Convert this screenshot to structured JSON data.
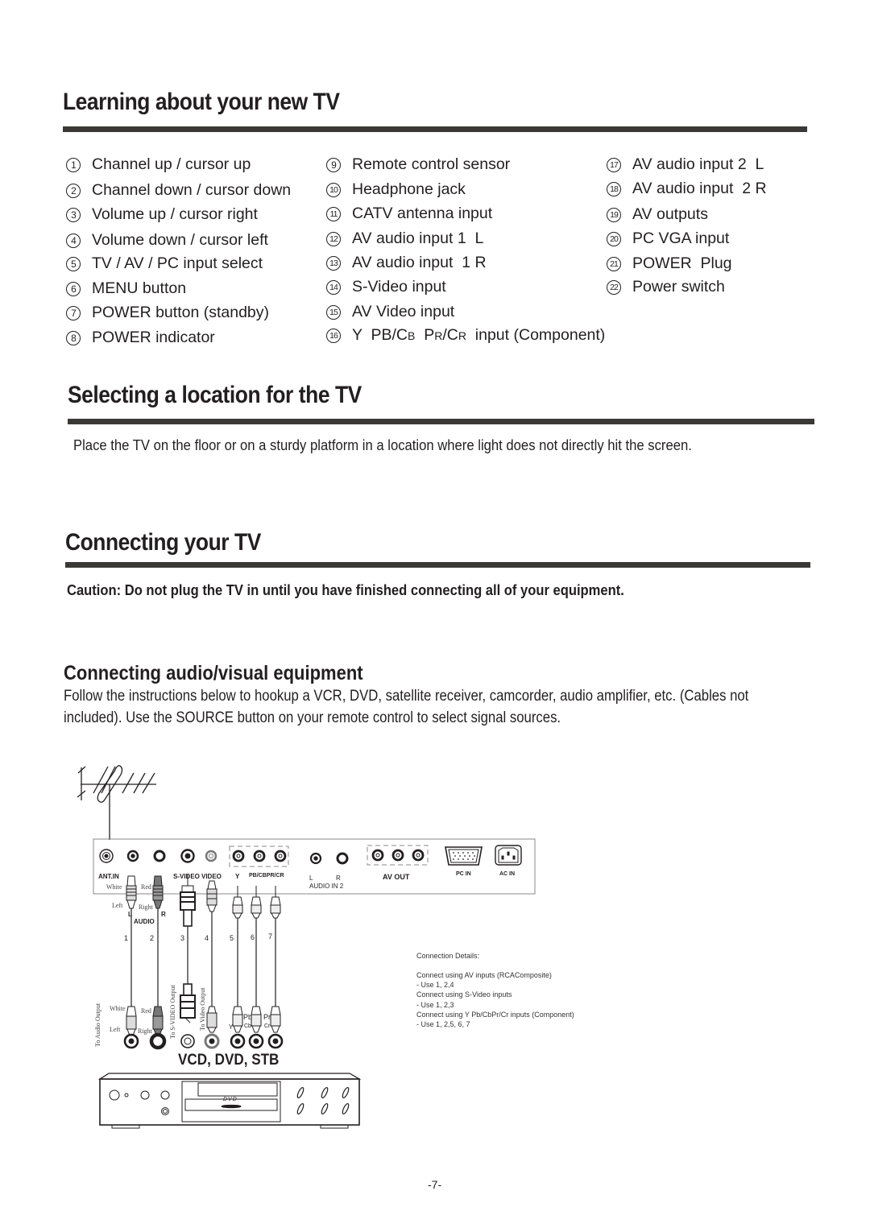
{
  "sections": {
    "learning": {
      "title": "Learning about your new TV",
      "items": [
        {
          "num": "1",
          "label": "Channel up / cursor up"
        },
        {
          "num": "2",
          "label": "Channel down / cursor down"
        },
        {
          "num": "3",
          "label": "Volume up / cursor right"
        },
        {
          "num": "4",
          "label": "Volume down / cursor left"
        },
        {
          "num": "5",
          "label": "TV / AV / PC input select"
        },
        {
          "num": "6",
          "label": "MENU button"
        },
        {
          "num": "7",
          "label": "POWER button (standby)"
        },
        {
          "num": "8",
          "label": "POWER indicator"
        },
        {
          "num": "9",
          "label": "Remote control sensor"
        },
        {
          "num": "10",
          "label": "Headphone jack"
        },
        {
          "num": "11",
          "label": "CATV antenna input"
        },
        {
          "num": "12",
          "label": "AV audio input 1  L"
        },
        {
          "num": "13",
          "label": "AV audio input  1 R"
        },
        {
          "num": "14",
          "label": "S-Video input"
        },
        {
          "num": "15",
          "label": "AV Video input"
        },
        {
          "num": "16",
          "label_parts": [
            "Y  PB/C",
            "B",
            "  P",
            "R",
            "/C",
            "R",
            "  input (Component)"
          ]
        },
        {
          "num": "17",
          "label": "AV audio input 2  L"
        },
        {
          "num": "18",
          "label": "AV audio input  2 R"
        },
        {
          "num": "19",
          "label": "AV outputs"
        },
        {
          "num": "20",
          "label": "PC VGA input"
        },
        {
          "num": "21",
          "label": "POWER  Plug"
        },
        {
          "num": "22",
          "label": "Power switch"
        }
      ]
    },
    "location": {
      "title": "Selecting a location for the TV",
      "text": "Place the TV on the floor or on a sturdy platform in a location where light does not directly hit the screen."
    },
    "connecting": {
      "title": "Connecting your TV",
      "caution": "Caution: Do not plug the TV in until you have finished connecting all of your equipment."
    },
    "av_equipment": {
      "title": "Connecting audio/visual equipment",
      "para_line1": "Follow the instructions below to hookup a VCR, DVD, satellite receiver, camcorder, audio amplifier, etc. (Cables not",
      "para_line2": " included). Use the SOURCE button on your remote control to select signal sources."
    }
  },
  "diagram": {
    "panel_labels": {
      "ant_in": "ANT.IN",
      "s_video": "S-VIDEO",
      "video": "VIDEO",
      "y": "Y",
      "pb_pr": "PB/CBPR/CR",
      "audio_l": "L",
      "audio_r": "R",
      "audio_in2": "AUDIO  IN 2",
      "av_out": "AV  OUT",
      "pc_in": "PC IN",
      "ac_in": "AC IN"
    },
    "cable_labels": {
      "white": "White",
      "red": "Red",
      "left": "Left",
      "right": "Right",
      "l": "L",
      "r": "R",
      "audio": "AUDIO"
    },
    "cable_numbers": [
      "1",
      "2",
      "3",
      "4",
      "5",
      "6",
      "7"
    ],
    "device_labels": {
      "to_audio_output": "To Audio Output",
      "to_svideo_output": "To S-VIDEO Output",
      "to_video_output": "To Video Output",
      "white": "White",
      "red": "Red",
      "left": "Left",
      "right": "Right",
      "y": "Y",
      "pb": "Pb",
      "cb": "Cb",
      "pr": "Pr",
      "cr": "Cr",
      "device_name": "VCD, DVD, STB",
      "dvd_logo": "DVD"
    },
    "connection_details": {
      "title": "Connection Details:",
      "lines": [
        "Connect using AV inputs (RCAComposite)",
        "- Use 1, 2,4",
        "Connect using S-Video inputs",
        "- Use 1, 2,3",
        "Connect using Y Pb/CbPr/Cr inputs (Component)",
        "- Use 1, 2,5, 6, 7"
      ]
    }
  },
  "page_number": "-7-"
}
